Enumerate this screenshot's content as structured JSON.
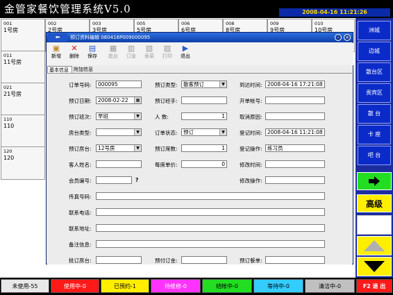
{
  "app": {
    "title": "金管家餐饮管理系统V5.0",
    "clock": "2008-04-16 11:21:26"
  },
  "rooms": [
    {
      "num": "001",
      "name": "1号房"
    },
    {
      "num": "002",
      "name": "2号房"
    },
    {
      "num": "003",
      "name": "3号房"
    },
    {
      "num": "005",
      "name": "5号房"
    },
    {
      "num": "006",
      "name": "6号房"
    },
    {
      "num": "008",
      "name": "8号房"
    },
    {
      "num": "009",
      "name": "9号房"
    },
    {
      "num": "010",
      "name": "10号房"
    },
    {
      "num": "011",
      "name": "11号房"
    },
    {
      "num": "021",
      "name": "21号房"
    },
    {
      "num": "110",
      "name": "110"
    },
    {
      "num": "120",
      "name": "120"
    }
  ],
  "right_panel": {
    "areas": [
      "洲城",
      "边城",
      "散台区",
      "贵宾区",
      "散 台",
      "卡 座",
      "吧 台"
    ],
    "advanced": "高级"
  },
  "status_bar": [
    {
      "label": "未使用-55",
      "bg": "#e8e8e8",
      "fg": "#000000"
    },
    {
      "label": "使用中-0",
      "bg": "#ff1a1a",
      "fg": "#ffffff"
    },
    {
      "label": "已预约-1",
      "bg": "#ffee00",
      "fg": "#000000"
    },
    {
      "label": "待维修-0",
      "bg": "#ff33ff",
      "fg": "#ffffff"
    },
    {
      "label": "结帐中-0",
      "bg": "#22dd22",
      "fg": "#000000"
    },
    {
      "label": "等待中-0",
      "bg": "#33ccff",
      "fg": "#000000"
    },
    {
      "label": "清洁中-0",
      "bg": "#c0c0c0",
      "fg": "#000000"
    },
    {
      "label": "F2 退 出",
      "bg": "#ff1a1a",
      "fg": "#ffffff"
    }
  ],
  "dialog": {
    "title": "预订资料编辑 080416P009000095",
    "toolbar": [
      {
        "label": "新增",
        "icon": "add-icon",
        "enabled": true
      },
      {
        "label": "删除",
        "icon": "delete-icon",
        "enabled": true
      },
      {
        "label": "保存",
        "icon": "save-icon",
        "enabled": true
      },
      {
        "label": "批台",
        "icon": "batch-table-icon",
        "enabled": false
      },
      {
        "label": "订金",
        "icon": "deposit-icon",
        "enabled": false
      },
      {
        "label": "香菜",
        "icon": "dish-icon",
        "enabled": false
      },
      {
        "label": "打印",
        "icon": "print-icon",
        "enabled": false
      },
      {
        "label": "退出",
        "icon": "exit-icon",
        "enabled": true
      }
    ],
    "tabs": [
      "基本信息",
      "附加信息"
    ],
    "form": {
      "order_no": {
        "label": "订单号码:",
        "value": "000095"
      },
      "order_date": {
        "label": "预订日期:",
        "value": "2008-02-22"
      },
      "shift": {
        "label": "预订班次:",
        "value": "早班"
      },
      "room_type": {
        "label": "房台类型:",
        "value": ""
      },
      "room": {
        "label": "预订房台:",
        "value": "12号房"
      },
      "guest": {
        "label": "客人姓名:",
        "value": ""
      },
      "member": {
        "label": "会员编号:",
        "value": "",
        "hint": "?"
      },
      "fax": {
        "label": "传真号码:",
        "value": ""
      },
      "phone": {
        "label": "联系电话:",
        "value": ""
      },
      "address": {
        "label": "联系地址:",
        "value": ""
      },
      "remark": {
        "label": "备注信息:",
        "value": ""
      },
      "batch_room": {
        "label": "批订房台:",
        "value": ""
      },
      "order_type": {
        "label": "预订类型:",
        "value": "散客预订"
      },
      "handler": {
        "label": "预订经手:",
        "value": ""
      },
      "people": {
        "label": "人    数:",
        "value": "1"
      },
      "status": {
        "label": "订单状态:",
        "value": "预订"
      },
      "tables": {
        "label": "预订席数:",
        "value": "1"
      },
      "price": {
        "label": "每席单价:",
        "value": "0"
      },
      "deposit": {
        "label": "预付订金:",
        "value": ""
      },
      "arrive_time": {
        "label": "到达时间:",
        "value": "2008-04-16 17:21:08"
      },
      "card_no": {
        "label": "开单帐号:",
        "value": ""
      },
      "cancel_reason": {
        "label": "取消原因:",
        "value": ""
      },
      "reg_time": {
        "label": "登记时间:",
        "value": "2008-04-16 11:21:08"
      },
      "reg_op": {
        "label": "登记操作:",
        "value": "练习员"
      },
      "mod_time": {
        "label": "修改时间:",
        "value": ""
      },
      "mod_op": {
        "label": "修改操作:",
        "value": ""
      },
      "order_menu": {
        "label": "预订餐单:",
        "value": ""
      }
    }
  }
}
